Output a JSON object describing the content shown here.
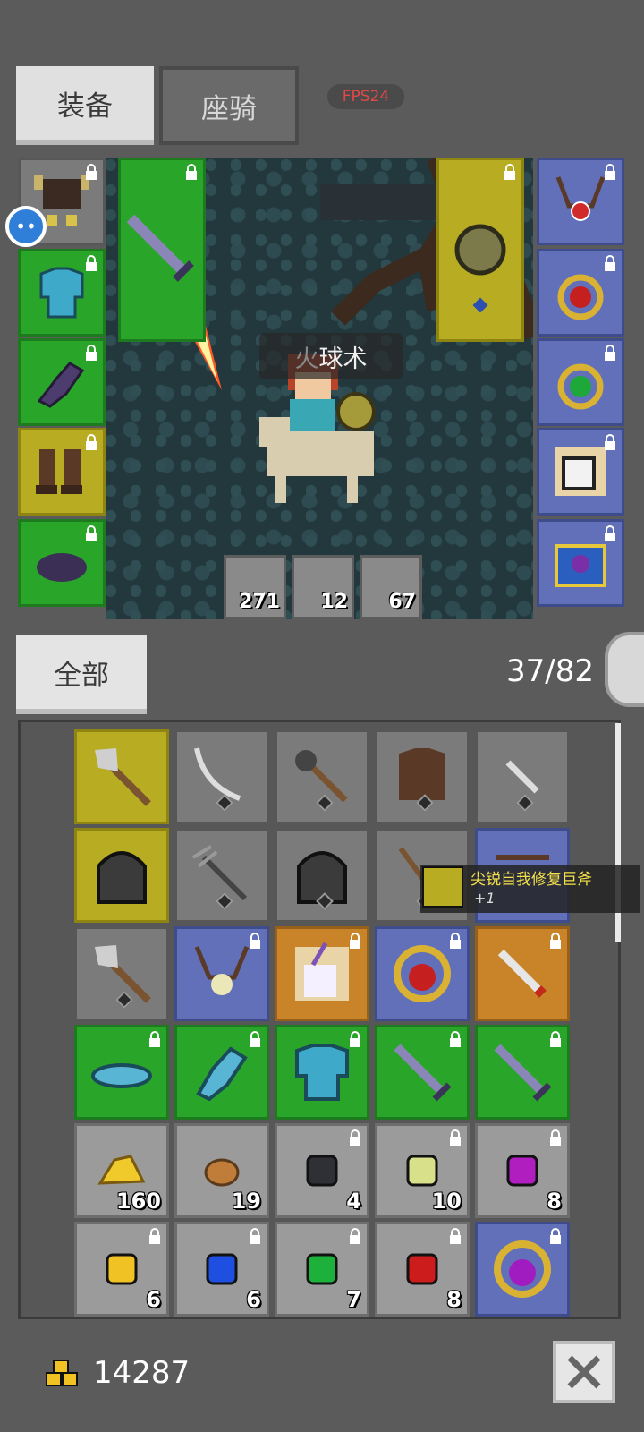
{
  "tabs": {
    "equip": "装备",
    "mount": "座骑"
  },
  "fps": "FPS24",
  "skill": {
    "faint": "火",
    "name": "球术"
  },
  "ammo": [
    {
      "count": "271",
      "icon": "red-feather-icon",
      "color": "#d83a2a"
    },
    {
      "count": "12",
      "icon": "cyan-feather-icon",
      "color": "#4fb7d4"
    },
    {
      "count": "67",
      "icon": "blue-feather-icon",
      "color": "#2e6fd6"
    }
  ],
  "filter": "全部",
  "capacity": "37/82",
  "tooltip": {
    "name": "尖锐自我修复巨斧",
    "sub": "+1"
  },
  "gold": "14287",
  "inventory_counts": {
    "gold_nugget": "160",
    "ore": "19",
    "black_gem": "4",
    "pale_gem": "10",
    "purple_gem": "8",
    "yellow_gem": "6",
    "blue_gem": "6",
    "green_gem": "7",
    "red_gem": "8"
  },
  "colors": {
    "green": "#29a62a",
    "yellow": "#b8ad22",
    "blue": "#6170b8",
    "gray": "#7b7b7b",
    "orange": "#c98429"
  }
}
